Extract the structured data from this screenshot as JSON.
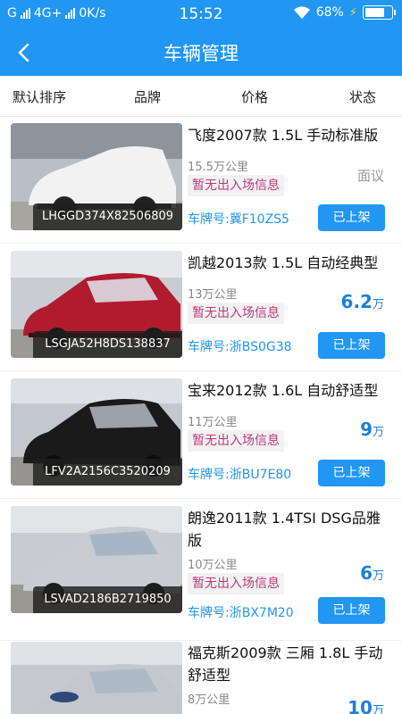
{
  "status": {
    "carrier": "G",
    "network": "4G+",
    "speed": "0K/s",
    "time": "15:52",
    "battery": "68%"
  },
  "header": {
    "title": "车辆管理"
  },
  "filters": [
    "默认排序",
    "品牌",
    "价格",
    "状态"
  ],
  "vehicles": [
    {
      "name": "飞度2007款 1.5L 手动标准版",
      "mileage": "15.5万公里",
      "entry": "暂无出入场信息",
      "plate": "车牌号:冀F10ZS5",
      "vin": "LHGGD374X82506809",
      "price": "面议",
      "price_unit": "",
      "action": "已上架",
      "color": "#f2f2f2"
    },
    {
      "name": "凯越2013款 1.5L 自动经典型",
      "mileage": "13万公里",
      "entry": "暂无出入场信息",
      "plate": "车牌号:浙BS0G38",
      "vin": "LSGJA52H8DS138837",
      "price": "6.2",
      "price_unit": "万",
      "action": "已上架",
      "color": "#b01c2e"
    },
    {
      "name": "宝来2012款 1.6L 自动舒适型",
      "mileage": "11万公里",
      "entry": "暂无出入场信息",
      "plate": "车牌号:浙BU7E80",
      "vin": "LFV2A2156C3520209",
      "price": "9",
      "price_unit": "万",
      "action": "已上架",
      "color": "#1a1a1a"
    },
    {
      "name": "朗逸2011款 1.4TSI DSG品雅版",
      "mileage": "10万公里",
      "entry": "暂无出入场信息",
      "plate": "车牌号:浙BX7M20",
      "vin": "LSVAD2186B2719850",
      "price": "6",
      "price_unit": "万",
      "action": "已上架",
      "color": "#c9ccd0"
    },
    {
      "name": "福克斯2009款 三厢 1.8L 手动舒适型",
      "mileage": "8万公里",
      "entry": "",
      "plate": "",
      "vin": "",
      "price": "10",
      "price_unit": "万",
      "action": "",
      "color": "#c4c7cb"
    }
  ]
}
